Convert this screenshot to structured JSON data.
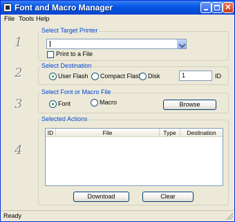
{
  "window": {
    "title": "Font and Macro Manager",
    "icons": {
      "app": "app-icon",
      "minimize": "minimize-icon",
      "maximize": "maximize-icon",
      "close": "close-icon"
    },
    "close_glyph": "✕"
  },
  "menu": {
    "file": "File",
    "tools": "Tools",
    "help": "Help"
  },
  "steps": {
    "one": "1",
    "two": "2",
    "three": "3",
    "four": "4"
  },
  "printer": {
    "label": "Select Target Printer",
    "value": "",
    "print_to_file": {
      "label": "Print to a File",
      "checked": false
    }
  },
  "destination": {
    "label": "Select Destination",
    "options": [
      "User Flash",
      "Compact Flash",
      "Disk"
    ],
    "selected": "User Flash",
    "id_value": "1",
    "id_label": "ID"
  },
  "file_type": {
    "label": "Select Font or Macro File",
    "options": [
      "Font",
      "Macro"
    ],
    "selected": "Font",
    "browse": "Browse"
  },
  "actions": {
    "label": "Selected Actions",
    "columns": [
      "ID",
      "File",
      "Type",
      "Destination"
    ],
    "rows": [],
    "download": "Download",
    "clear": "Clear"
  },
  "status": {
    "text": "Ready"
  },
  "colors": {
    "group_label": "#0046d5",
    "titlebar": "#0a5ae8",
    "radio_selected": "#21a121"
  }
}
